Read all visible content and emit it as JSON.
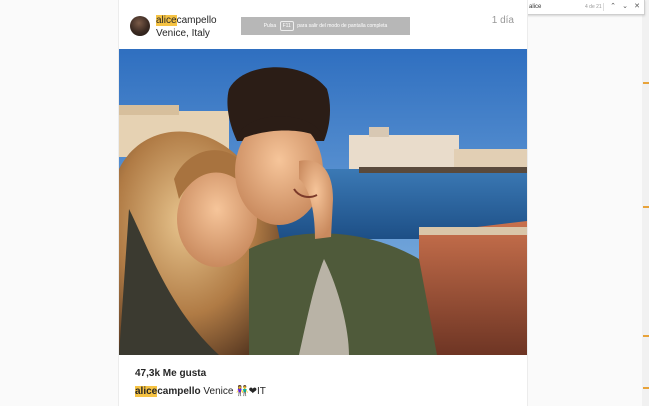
{
  "findbar": {
    "query": "alice",
    "count": "4 de 21",
    "up_icon": "chevron-up-icon",
    "down_icon": "chevron-down-icon",
    "close_icon": "close-icon"
  },
  "fullscreen_notice": {
    "before": "Pulsa",
    "key": "F11",
    "after": "para salir del modo de pantalla completa"
  },
  "post": {
    "username_match": "alice",
    "username_rest": "campello",
    "location": "Venice, Italy",
    "time": "1 día",
    "likes": "47,3k Me gusta",
    "caption_user_match": "alice",
    "caption_user_rest": "campello",
    "caption_text": "Venice 👫❤IT"
  },
  "colors": {
    "highlight": "#f6c343",
    "scroll_marker": "#e8a33a"
  }
}
